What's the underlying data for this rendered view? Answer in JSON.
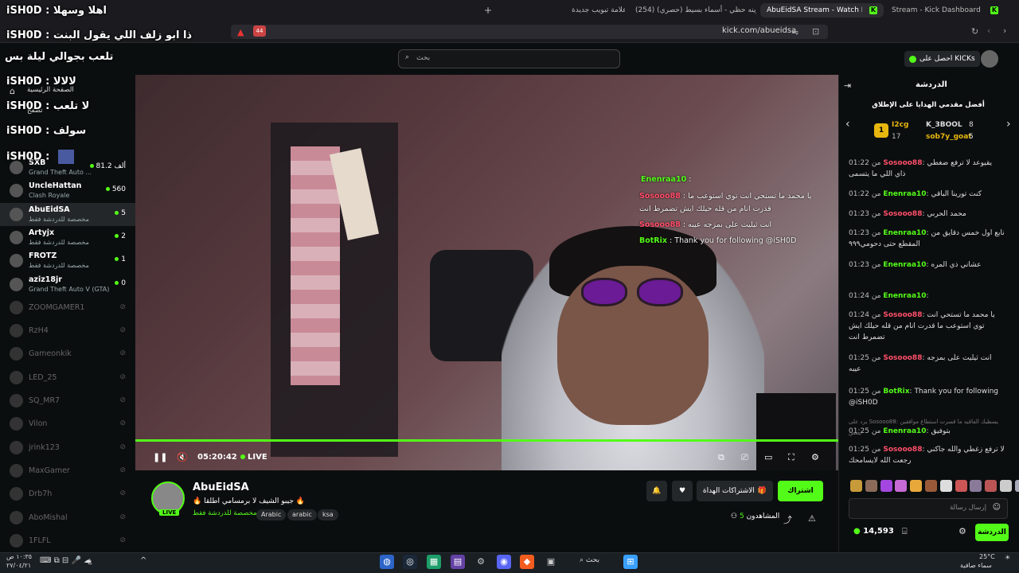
{
  "browser": {
    "tabs": [
      {
        "label": "Stream - Kick Dashboard",
        "active": false
      },
      {
        "label": "AbuEidSA Stream - Watch Live o",
        "active": true
      },
      {
        "label": "(254) وينه حظي - أسماء بسيط (حصري)",
        "active": false
      },
      {
        "label": "علامة تبويب جديدة",
        "active": false
      }
    ],
    "new_tab": "+",
    "url": "kick.com/abueidsa",
    "ext_badge": "44"
  },
  "header": {
    "search_placeholder": "بحث",
    "get_kicks": "احصل على KICKs"
  },
  "overlay_chat": [
    {
      "name": "iSH0D",
      "text": "اهلا وسهلا"
    },
    {
      "name": "iSH0D",
      "text": "ذا ابو زلف اللي يقول البنت"
    },
    {
      "name": "",
      "text": "تلعب بجوالي ليلة بس"
    },
    {
      "name": "iSH0D",
      "text": "لالالا"
    },
    {
      "name": "iSH0D",
      "text": "لا تلعب"
    },
    {
      "name": "iSH0D",
      "text": "سولف"
    },
    {
      "name": "iSH0D",
      "text": ""
    }
  ],
  "sidebar": {
    "home_label": "الصفحة الرئيسية",
    "browse_label": "تصفح",
    "channels": [
      {
        "name": "SXB",
        "game": "Grand Theft Auto ...",
        "viewers": "81.2 ألف",
        "online": true
      },
      {
        "name": "UncleHattan",
        "game": "Clash Royale",
        "viewers": "560",
        "online": true
      },
      {
        "name": "AbuEidSA",
        "game": "مخصصة للدردشة فقط",
        "viewers": "5",
        "online": true,
        "active": true
      },
      {
        "name": "Artyjx",
        "game": "مخصصة للدردشة فقط",
        "viewers": "2",
        "online": true
      },
      {
        "name": "FROTZ",
        "game": "مخصصة للدردشة فقط",
        "viewers": "1",
        "online": true
      },
      {
        "name": "aziz18jr",
        "game": "Grand Theft Auto V (GTA)",
        "viewers": "0",
        "online": true
      },
      {
        "name": "ZOOMGAMER1",
        "online": false
      },
      {
        "name": "RzH4",
        "online": false
      },
      {
        "name": "Gameonkik",
        "online": false
      },
      {
        "name": "LED_25",
        "online": false
      },
      {
        "name": "SQ_MR7",
        "online": false
      },
      {
        "name": "Vilon",
        "online": false
      },
      {
        "name": "jrink123",
        "online": false
      },
      {
        "name": "MaxGamer",
        "online": false
      },
      {
        "name": "Drb7h",
        "online": false
      },
      {
        "name": "AboMishal",
        "online": false
      },
      {
        "name": "1FLFL",
        "online": false
      }
    ]
  },
  "player": {
    "time": "05:20:42",
    "live_label": "LIVE",
    "video_chat": [
      {
        "user": "Enenraa10",
        "text": ""
      },
      {
        "user": "Sosooo88",
        "text": "يا محمد ما تستحي انت توي استوعب ما"
      },
      {
        "user": "",
        "text": "قدرت انام من قله حيلك ايش تضمرط انت"
      },
      {
        "user": "Sosooo88",
        "text": "انت ثيليت على بمزجه عيبه"
      },
      {
        "user": "BotRix",
        "text": "Thank you for following @iSH0D"
      }
    ]
  },
  "channel": {
    "name": "AbuEidSA",
    "live_badge": "LIVE",
    "title": "🔥 جيبو الشيف لا برمسامي اطلقا 🔥",
    "category": "مخصصة للدردشة فقط",
    "tags": [
      "Arabic",
      "arabic",
      "ksa"
    ],
    "subscribe_label": "اشتراك",
    "gift_label": "الاشتراكات الهداة",
    "viewers_label": "المشاهدون",
    "viewers_count": "5"
  },
  "chat": {
    "title": "الدردشة",
    "top_gifters_title": "أفضل مقدمي الهدايا على الإطلاق",
    "gifters": [
      {
        "name": "I2cg",
        "count": "17",
        "rank": "1"
      },
      {
        "name": "K_3BOOL",
        "count": "8"
      },
      {
        "name": "sob7y_goat",
        "count": "5"
      }
    ],
    "messages": [
      {
        "time": "01:22",
        "user": "Sosooo88",
        "color": "#ff4e6a",
        "text": "يقيوعد لا ترفع ضغطي ذاي اللي ما يتسمى"
      },
      {
        "time": "01:22",
        "user": "Enenraa10",
        "color": "#53fc18",
        "text": "كنت تورينا الباقي"
      },
      {
        "time": "01:23",
        "user": "Sosooo88",
        "color": "#ff4e6a",
        "text": "محمد الحربي"
      },
      {
        "time": "01:23",
        "user": "Enenraa10",
        "color": "#53fc18",
        "text": "نابع اول خمس دقايق من المقطع حتى دحومي٩٩٩"
      },
      {
        "time": "01:23",
        "user": "Enenraa10",
        "color": "#53fc18",
        "text": "عشاني ذي المره"
      },
      {
        "time": "01:24",
        "user": "Enenraa10",
        "color": "#53fc18",
        "text": ""
      },
      {
        "time": "01:24",
        "user": "Sosooo88",
        "color": "#ff4e6a",
        "text": "يا محمد ما تستحي انت توي استوعب ما قدرت انام من قله حيلك ايش تضمرط انت"
      },
      {
        "time": "01:25",
        "user": "Sosooo88",
        "color": "#ff4e6a",
        "text": "انت ثيليت على بمزجه عيبه"
      },
      {
        "time": "01:25",
        "user": "BotRix",
        "color": "#53fc18",
        "text": "Thank you for following @iSH0D"
      },
      {
        "time": "01:25",
        "user": "Enenraa10",
        "color": "#53fc18",
        "text": "بتوفيق"
      },
      {
        "time": "01:25",
        "user": "Sosooo88",
        "color": "#ff4e6a",
        "text": "لا ترفع زغطي والله جاكني رجعت الله لايسامحك"
      }
    ],
    "reply_hint": "يرد على Sosooo88: يسطيك الفاقيه ما قسرت استطاع موافقين ببعض",
    "time_prefix": "من",
    "input_placeholder": "إرسال رسالة",
    "points": "14,593",
    "send_label": "الدردشة"
  },
  "taskbar": {
    "search_label": "بحث",
    "time": "١٠:٣٥ ص",
    "date": "٢٧/٠٤/٢١",
    "weather_temp": "25°C",
    "weather_desc": "سماء صافية",
    "lang": "ع"
  }
}
